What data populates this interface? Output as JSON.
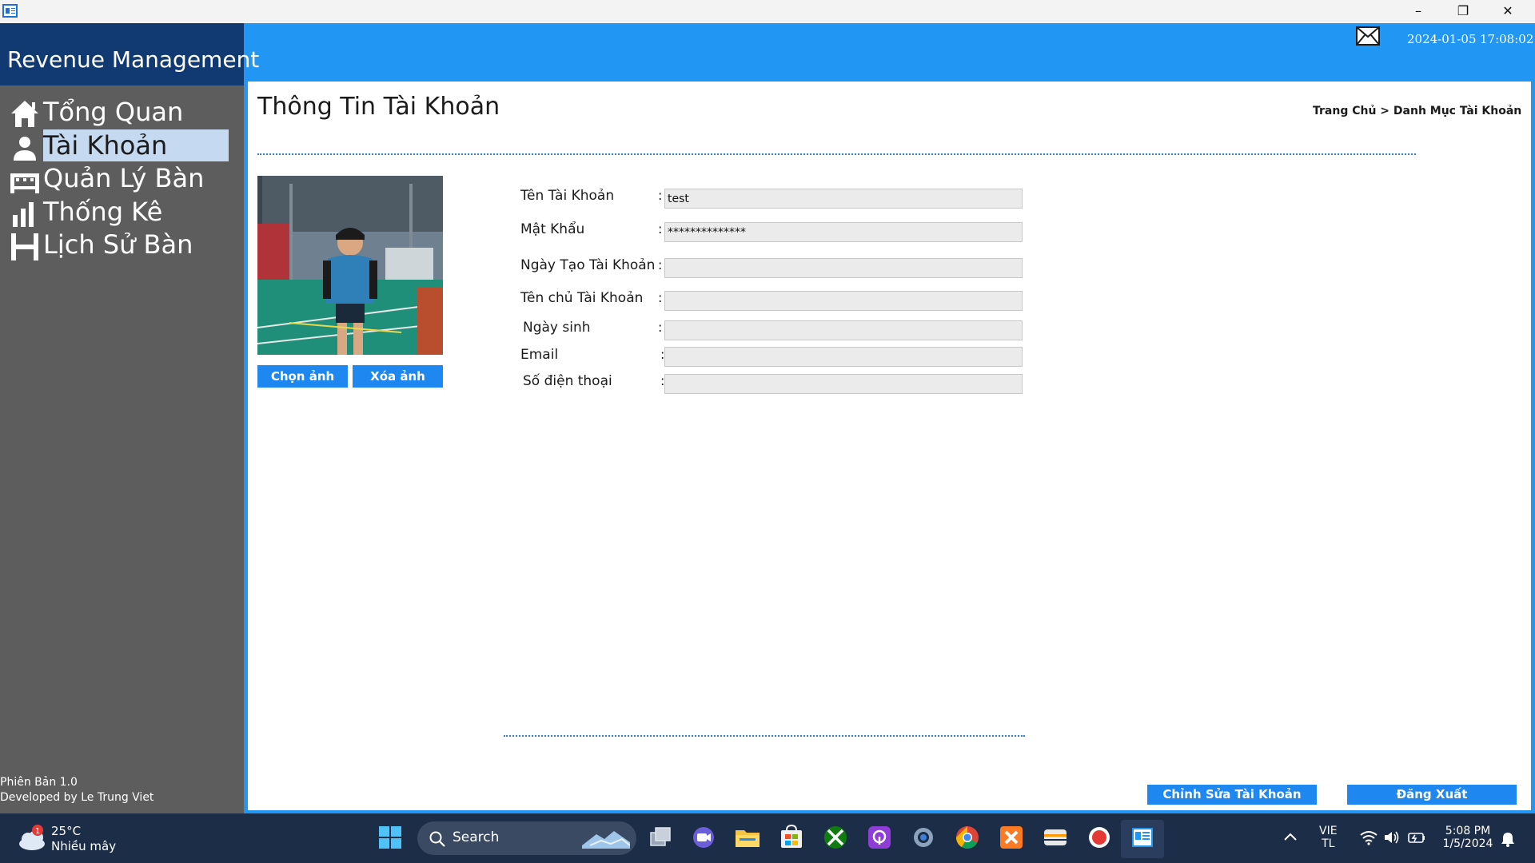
{
  "window": {
    "minimize": "–",
    "restore": "❐",
    "close": "✕"
  },
  "header": {
    "date": "2024-01-05",
    "time": "17:08:02"
  },
  "sidebar": {
    "brand": "Revenue Management",
    "items": [
      {
        "label": "Tổng Quan",
        "icon": "home-icon"
      },
      {
        "label": "Tài Khoản",
        "icon": "user-icon",
        "active": true
      },
      {
        "label": "Quản Lý Bàn",
        "icon": "table-icon"
      },
      {
        "label": "Thống Kê",
        "icon": "bar-chart-icon"
      },
      {
        "label": "Lịch Sử Bàn",
        "icon": "history-icon"
      }
    ],
    "version": "Phiên Bản 1.0",
    "developer": "Developed by Le Trung Viet"
  },
  "main": {
    "title": "Thông Tin Tài Khoản",
    "breadcrumb": "Trang Chủ > Danh Mục Tài Khoản",
    "choose_photo": "Chọn ảnh",
    "delete_photo": "Xóa ảnh",
    "fields": [
      {
        "label": "Tên Tài Khoản",
        "value": "test"
      },
      {
        "label": "Mật Khẩu",
        "value": "**************"
      },
      {
        "label": "Ngày Tạo Tài Khoản",
        "value": ""
      },
      {
        "label": "Tên chủ Tài Khoản",
        "value": ""
      },
      {
        "label": "Ngày sinh",
        "value": ""
      },
      {
        "label": "Email",
        "value": ""
      },
      {
        "label": "Số điện thoại",
        "value": ""
      }
    ],
    "edit_button": "Chỉnh Sửa Tài Khoản",
    "logout_button": "Đăng Xuất"
  },
  "taskbar": {
    "weather_badge": "1",
    "temperature": "25°C",
    "weather": "Nhiều mây",
    "search": "Search",
    "lang_top": "VIE",
    "lang_bottom": "TL",
    "clock_time": "5:08 PM",
    "clock_date": "1/5/2024"
  },
  "colors": {
    "accent": "#2196f3",
    "sidebar": "#5d5d5d",
    "brand_bg": "#113a72",
    "active_item": "#c5d9f0",
    "button": "#1e88f0",
    "taskbar": "#1c2d48"
  }
}
